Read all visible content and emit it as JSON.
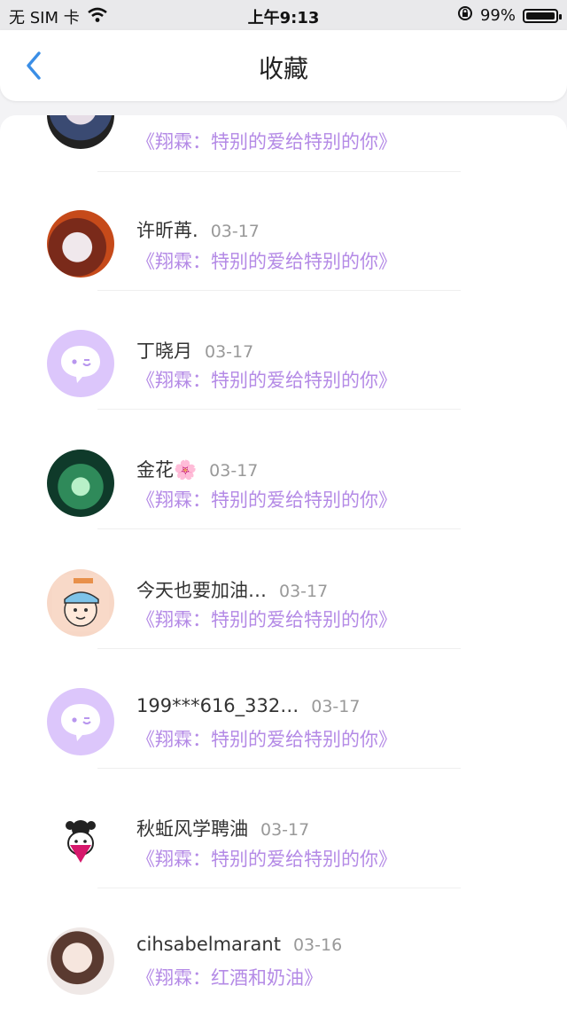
{
  "status_bar": {
    "carrier": "无 SIM 卡",
    "time": "上午9:13",
    "battery": "99%",
    "battery_level": 0.99,
    "wifi_icon": "wifi-icon",
    "lock_icon": "orientation-lock-icon"
  },
  "nav": {
    "title": "收藏",
    "back_icon": "chevron-left-icon"
  },
  "colors": {
    "accent": "#4a90d9",
    "song": "#b48ae6",
    "default_avatar": "#dcc6fb"
  },
  "items": [
    {
      "name": "",
      "date": "",
      "song": "《翔霖：特别的爱给特别的你》",
      "avatar": "photo"
    },
    {
      "name": "许昕苒.",
      "date": "03-17",
      "song": "《翔霖：特别的爱给特别的你》",
      "avatar": "photo"
    },
    {
      "name": "丁晓月",
      "date": "03-17",
      "song": "《翔霖：特别的爱给特别的你》",
      "avatar": "default"
    },
    {
      "name": "金花🌸",
      "date": "03-17",
      "song": "《翔霖：特别的爱给特别的你》",
      "avatar": "photo"
    },
    {
      "name": "今天也要加油…",
      "date": "03-17",
      "song": "《翔霖：特别的爱给特别的你》",
      "avatar": "cartoon"
    },
    {
      "name": "199***616_332…",
      "date": "03-17",
      "song": "《翔霖：特别的爱给特别的你》",
      "avatar": "default"
    },
    {
      "name": "秋蚯风学聘浀",
      "date": "03-17",
      "song": "《翔霖：特别的爱给特别的你》",
      "avatar": "sketch"
    },
    {
      "name": "cihsabelmarant",
      "date": "03-16",
      "song": "《翔霖：红酒和奶油》",
      "avatar": "photo"
    }
  ]
}
